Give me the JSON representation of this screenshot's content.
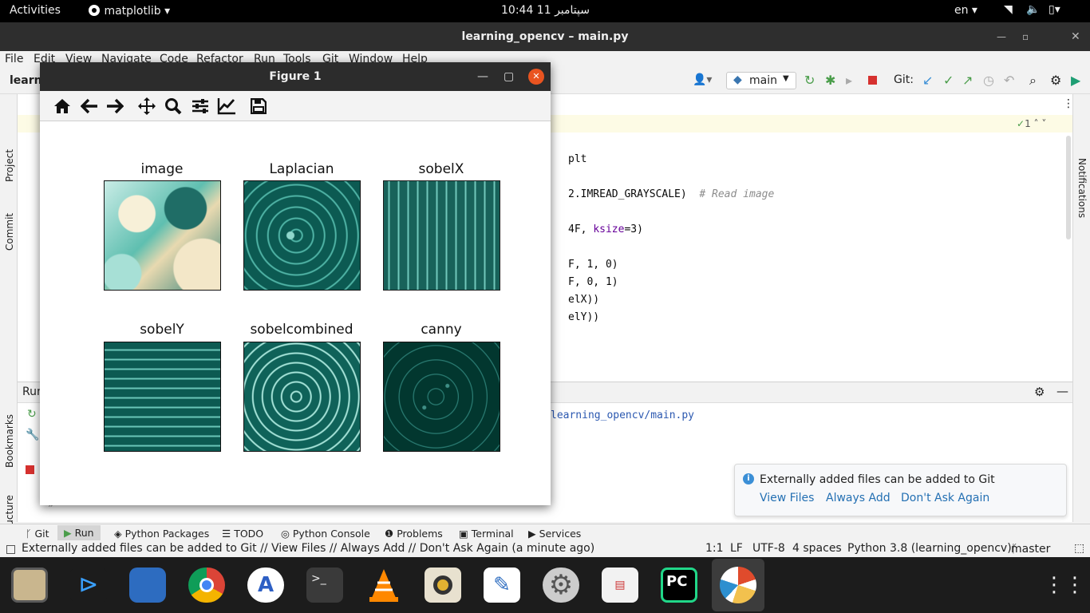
{
  "topbar": {
    "activities": "Activities",
    "app": "matplotlib ▾",
    "clock": "10:44  سپتامبر 11",
    "lang": "en ▾"
  },
  "window": {
    "title": "learning_opencv – main.py"
  },
  "menu": [
    "File",
    "Edit",
    "View",
    "Navigate",
    "Code",
    "Refactor",
    "Run",
    "Tools",
    "Git",
    "Window",
    "Help"
  ],
  "toolbar": {
    "project_crumb": "learn",
    "branch": "main",
    "git_label": "Git:"
  },
  "left_tools": {
    "project": "Project",
    "commit": "Commit",
    "bookmarks": "Bookmarks",
    "structure": "Structure"
  },
  "right_tools": {
    "notifications": "Notifications"
  },
  "editor": {
    "inspect_count": "1",
    "lines": [
      {
        "t1": "plt",
        "t2": "",
        "t3": ""
      },
      {
        "t1": "2.IMREAD_GRAYSCALE)  ",
        "t2": "# Read image",
        "t3": ""
      },
      {
        "t1": "4F, ",
        "t2": "ksize",
        "t3": "=3)"
      },
      {
        "t1": "F, 1, 0)",
        "t2": "",
        "t3": ""
      },
      {
        "t1": "F, 0, 1)",
        "t2": "",
        "t3": ""
      },
      {
        "t1": "elX))",
        "t2": "",
        "t3": ""
      },
      {
        "t1": "elY))",
        "t2": "",
        "t3": ""
      }
    ]
  },
  "run_panel": {
    "label": "Run",
    "path": "learning_opencv/main.py"
  },
  "notification": {
    "message": "Externally added files can be added to Git",
    "view_files": "View Files",
    "always_add": "Always Add",
    "dont_ask": "Don't Ask Again"
  },
  "bottom_tools": [
    "Git",
    "Run",
    "Python Packages",
    "TODO",
    "Python Console",
    "Problems",
    "Terminal",
    "Services"
  ],
  "status": {
    "message": "Externally added files can be added to Git // View Files // Always Add // Don't Ask Again (a minute ago)",
    "position": "1:1",
    "line_sep": "LF",
    "encoding": "UTF-8",
    "indent": "4 spaces",
    "interpreter": "Python 3.8 (learning_opencv)",
    "branch": "master"
  },
  "figure": {
    "title": "Figure 1",
    "subplots": [
      {
        "title": "image",
        "style": "color"
      },
      {
        "title": "Laplacian",
        "style": "edge"
      },
      {
        "title": "sobelX",
        "style": "edge"
      },
      {
        "title": "sobelY",
        "style": "edge"
      },
      {
        "title": "sobelcombined",
        "style": "bright"
      },
      {
        "title": "canny",
        "style": "dark"
      }
    ]
  },
  "dock": [
    "files-icon",
    "vscode-icon",
    "virtualbox-icon",
    "chrome-icon",
    "app-store-icon",
    "terminal-icon",
    "vlc-icon",
    "rhythmbox-icon",
    "text-editor-icon",
    "settings-icon",
    "document-viewer-icon",
    "pycharm-icon",
    "matplotlib-icon",
    "apps-grid-icon"
  ]
}
